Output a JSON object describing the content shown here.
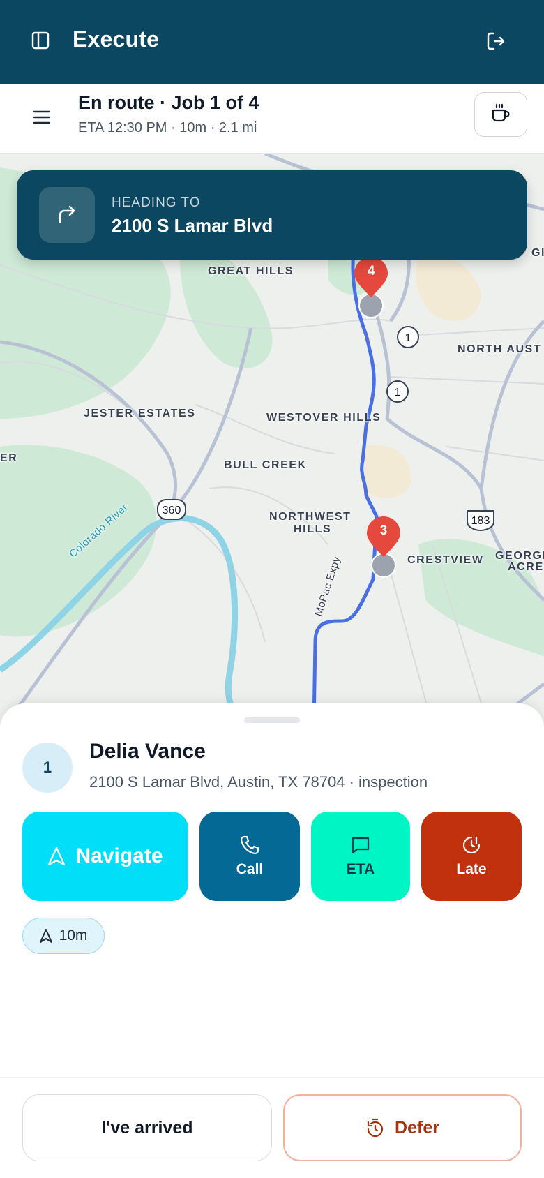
{
  "app": {
    "title": "Execute"
  },
  "status": {
    "title": "En route · Job 1 of 4",
    "subtitle": "ETA 12:30 PM · 10m · 2.1 mi"
  },
  "heading": {
    "kicker": "HEADING TO",
    "address": "2100 S Lamar Blvd"
  },
  "map": {
    "labels": [
      "GREAT HILLS",
      "NORTH AUST",
      "JESTER ESTATES",
      "WESTOVER HILLS",
      "BULL CREEK",
      "NORTHWEST",
      "HILLS",
      "CRESTVIEW",
      "GEORGI",
      "ACRE",
      "ER",
      "GI",
      "Colorado River",
      "MoPac Expy"
    ],
    "road_shields": [
      "1",
      "1",
      "360",
      "183"
    ],
    "markers": [
      {
        "label": "4",
        "color": "#e5483d"
      },
      {
        "label": "3",
        "color": "#e5483d"
      }
    ],
    "route_color": "#4a6fe3"
  },
  "customer": {
    "sequence": "1",
    "name": "Delia Vance",
    "address": "2100 S Lamar Blvd, Austin, TX 78704 · inspection"
  },
  "actions": {
    "navigate": "Navigate",
    "call": "Call",
    "eta": "ETA",
    "late": "Late"
  },
  "chip": {
    "label": "10m"
  },
  "footer": {
    "arrived": "I've arrived",
    "defer": "Defer"
  },
  "colors": {
    "brand": "#0b4761",
    "navigate": "#00def8",
    "call": "#056996",
    "eta": "#00f5c5",
    "late": "#c2310d"
  }
}
